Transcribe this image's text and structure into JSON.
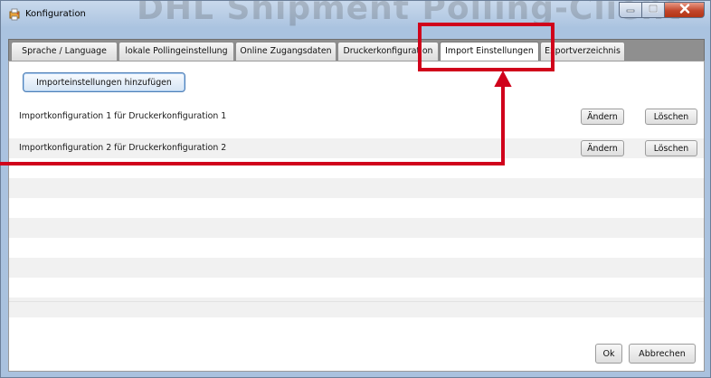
{
  "window": {
    "title": "Konfiguration",
    "watermark": "DHL Shipment Polling-Client"
  },
  "tabs": [
    {
      "label": "Sprache / Language",
      "active": false
    },
    {
      "label": "lokale Pollingeinstellung",
      "active": false
    },
    {
      "label": "Online Zugangsdaten",
      "active": false
    },
    {
      "label": "Druckerkonfiguration",
      "active": false
    },
    {
      "label": "Import Einstellungen",
      "active": true
    },
    {
      "label": "Exportverzeichnis",
      "active": false
    }
  ],
  "toolbar": {
    "add_label": "Importeinstellungen hinzufügen"
  },
  "list": {
    "rows": [
      {
        "label": "Importkonfiguration 1 für Druckerkonfiguration 1",
        "edit": "Ändern",
        "delete": "Löschen"
      },
      {
        "label": "Importkonfiguration 2 für Druckerkonfiguration 2",
        "edit": "Ändern",
        "delete": "Löschen"
      }
    ]
  },
  "footer": {
    "ok_label": "Ok",
    "cancel_label": "Abbrechen"
  },
  "icons": {
    "app": "printer-config-icon",
    "minimize": "minimize-icon",
    "maximize": "maximize-icon",
    "close": "close-icon"
  },
  "colors": {
    "highlight": "#d0021b",
    "title_bar": "#aac3e0",
    "row_alt": "#f1f1f1"
  }
}
